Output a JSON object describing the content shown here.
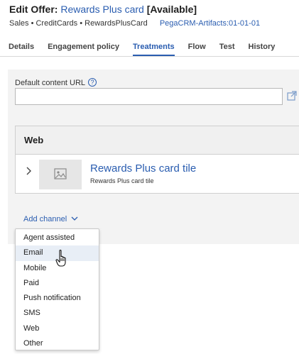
{
  "header": {
    "title_prefix": "Edit  Offer:",
    "offer_name": "Rewards Plus card",
    "status": "[Available]",
    "breadcrumb": "Sales • CreditCards • RewardsPlusCard",
    "ruleset": "PegaCRM-Artifacts:01-01-01"
  },
  "tabs": [
    {
      "label": "Details"
    },
    {
      "label": "Engagement policy"
    },
    {
      "label": "Treatments"
    },
    {
      "label": "Flow"
    },
    {
      "label": "Test"
    },
    {
      "label": "History"
    }
  ],
  "active_tab": "Treatments",
  "content_url": {
    "label": "Default content URL",
    "help": "?",
    "value": ""
  },
  "web_channel": {
    "header": "Web",
    "tile_title": "Rewards Plus card tile",
    "tile_subtitle": "Rewards Plus card tile"
  },
  "add_channel": {
    "label": "Add channel",
    "options": [
      {
        "label": "Agent assisted"
      },
      {
        "label": "Email"
      },
      {
        "label": "Mobile"
      },
      {
        "label": "Paid"
      },
      {
        "label": "Push notification"
      },
      {
        "label": "SMS"
      },
      {
        "label": "Web"
      },
      {
        "label": "Other"
      }
    ],
    "hovered": "Email"
  },
  "colors": {
    "link": "#2a5db0",
    "panel": "#f3f3f3",
    "hover": "#e8eef6"
  },
  "icons": [
    "help-icon",
    "external-link-icon",
    "chevron-right-icon",
    "image-placeholder-icon",
    "chevron-down-icon",
    "hand-pointer-icon"
  ]
}
